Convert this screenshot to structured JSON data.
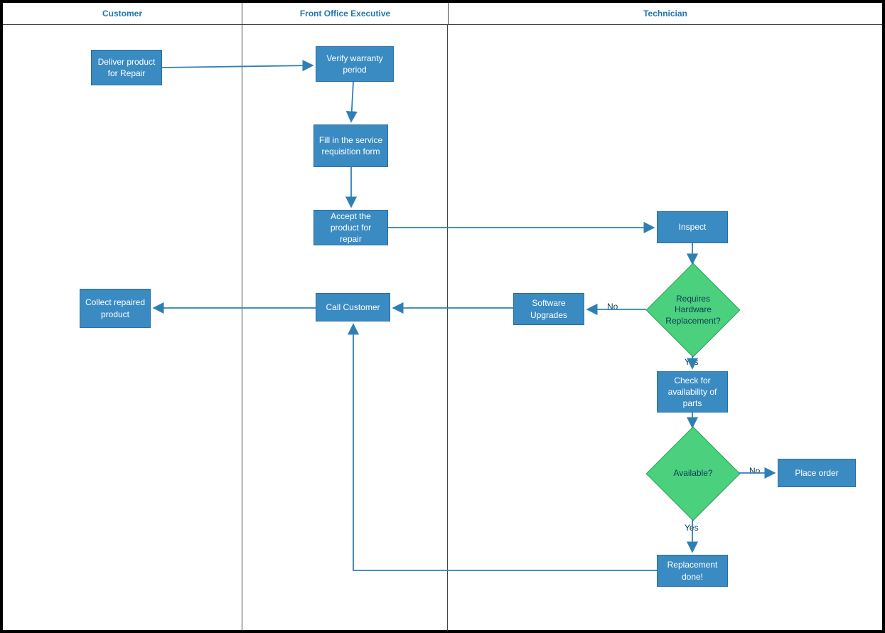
{
  "lanes": {
    "customer": "Customer",
    "frontOffice": "Front Office Executive",
    "technician": "Technician"
  },
  "nodes": {
    "deliver": "Deliver product for Repair",
    "verify": "Verify warranty period",
    "fillForm": "Fill in the service requisition form",
    "accept": "Accept the product for repair",
    "inspect": "Inspect",
    "reqHw": "Requires Hardware Replacement?",
    "software": "Software Upgrades",
    "callCustomer": "Call Customer",
    "collect": "Collect repaired product",
    "checkParts": "Check for availability of parts",
    "available": "Available?",
    "placeOrder": "Place order",
    "replacement": "Replacement done!"
  },
  "edgeLabels": {
    "no": "No",
    "yes": "Yes"
  },
  "colors": {
    "process": "#3B8BC3",
    "decision": "#4bd07d",
    "laneHeader": "#1f75b3",
    "edge": "#2f7fb7"
  }
}
